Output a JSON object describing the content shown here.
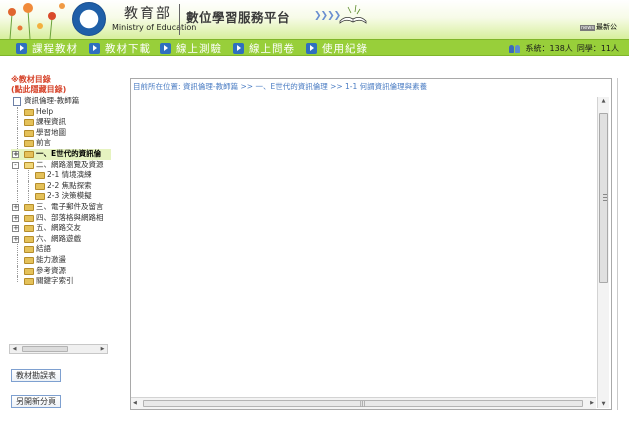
{
  "header": {
    "ministry_zh": "教育部",
    "ministry_en": "Ministry of Education",
    "platform_title": "數位學習服務平台",
    "news_tag": "news",
    "news_text": "最新公"
  },
  "nav": {
    "items": [
      {
        "label": "課程教材",
        "icon": "play-arrow-icon"
      },
      {
        "label": "教材下載",
        "icon": "play-arrow-icon"
      },
      {
        "label": "線上測驗",
        "icon": "play-arrow-icon"
      },
      {
        "label": "線上問卷",
        "icon": "play-arrow-icon"
      },
      {
        "label": "使用紀錄",
        "icon": "play-arrow-icon"
      }
    ],
    "status": {
      "system_label": "系統：",
      "system_count": "138人",
      "classmates_label": "同學：",
      "classmates_count": "11人"
    }
  },
  "sidebar": {
    "title_line1": "※教材目錄",
    "title_line2": "(點此隱藏目錄)",
    "tree": [
      {
        "label": "資訊倫理-教師篇",
        "type": "doc"
      },
      {
        "label": "Help",
        "type": "folder"
      },
      {
        "label": "課程資訊",
        "type": "folder"
      },
      {
        "label": "學習地圖",
        "type": "folder"
      },
      {
        "label": "前言",
        "type": "folder"
      },
      {
        "label": "一、E世代的資訊倫",
        "type": "folder",
        "expander": "+",
        "selected": true
      },
      {
        "label": "二、網路瀏覽及資源",
        "type": "folder",
        "expander": "-"
      },
      {
        "label": "2-1 情境演練",
        "type": "folder",
        "child": true
      },
      {
        "label": "2-2 焦點探索",
        "type": "folder",
        "child": true
      },
      {
        "label": "2-3 決策模擬",
        "type": "folder",
        "child": true
      },
      {
        "label": "三、電子郵件及留言",
        "type": "folder",
        "expander": "+"
      },
      {
        "label": "四、部落格與網路相",
        "type": "folder",
        "expander": "+"
      },
      {
        "label": "五、網路交友",
        "type": "folder",
        "expander": "+"
      },
      {
        "label": "六、網路遊戲",
        "type": "folder",
        "expander": "+"
      },
      {
        "label": "結語",
        "type": "folder"
      },
      {
        "label": "能力激盪",
        "type": "folder"
      },
      {
        "label": "參考資源",
        "type": "folder"
      },
      {
        "label": "關鍵字索引",
        "type": "folder"
      }
    ],
    "buttons": {
      "errata": "教材勘誤表",
      "new_page": "另開新分頁"
    }
  },
  "content": {
    "breadcrumb": "目前所在位置: 資訊倫理-教師篇 >> 一、E世代的資訊倫理 >> 1-1 何謂資訊倫理與素養"
  }
}
